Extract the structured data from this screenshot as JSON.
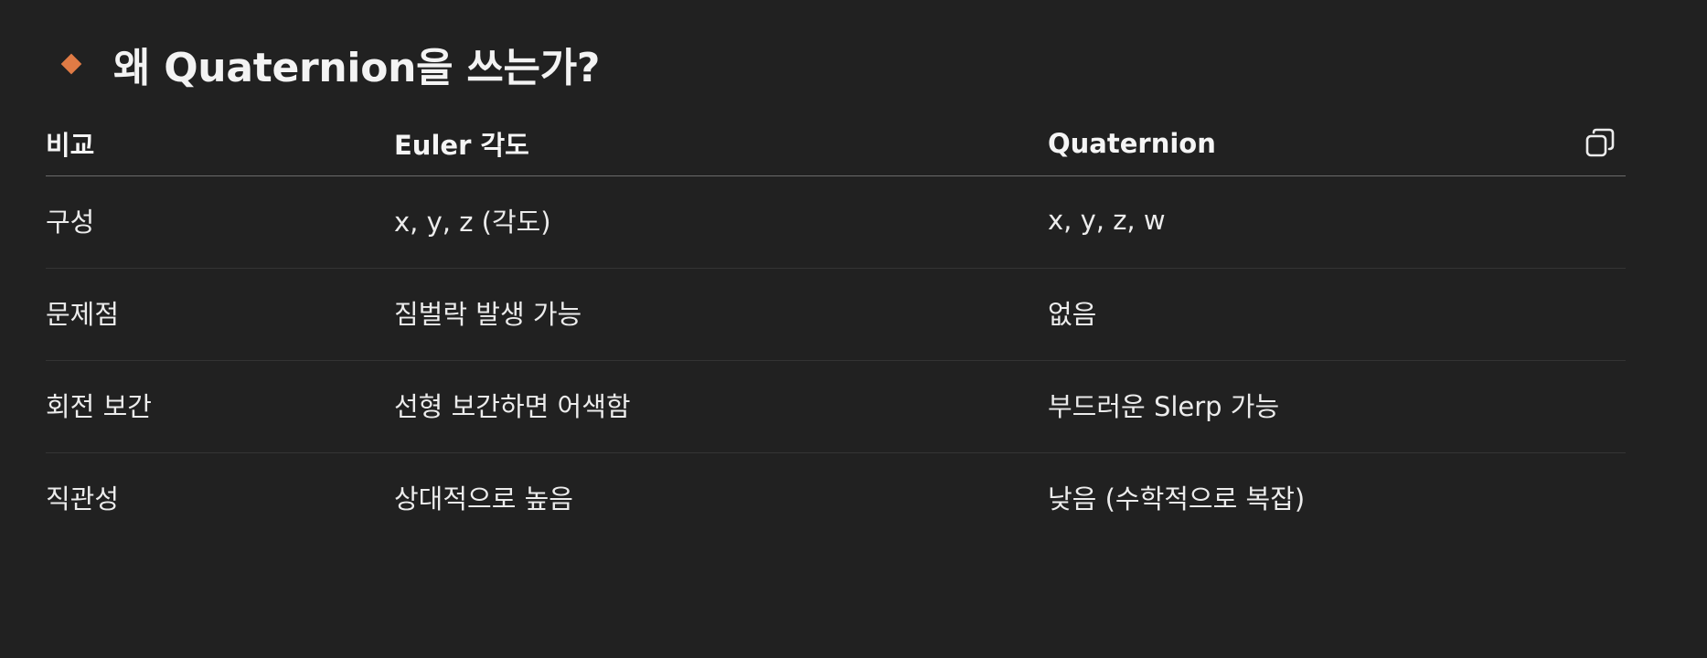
{
  "heading": {
    "bullet_color": "#e07b45",
    "title": "왜 Quaternion을 쓰는가?"
  },
  "table": {
    "headers": [
      "비교",
      "Euler 각도",
      "Quaternion"
    ],
    "rows": [
      [
        "구성",
        "x, y, z (각도)",
        "x, y, z, w"
      ],
      [
        "문제점",
        "짐벌락 발생 가능",
        "없음"
      ],
      [
        "회전 보간",
        "선형 보간하면 어색함",
        "부드러운 Slerp 가능"
      ],
      [
        "직관성",
        "상대적으로 높음",
        "낮음 (수학적으로 복잡)"
      ]
    ],
    "copy_icon": "copy-icon"
  }
}
